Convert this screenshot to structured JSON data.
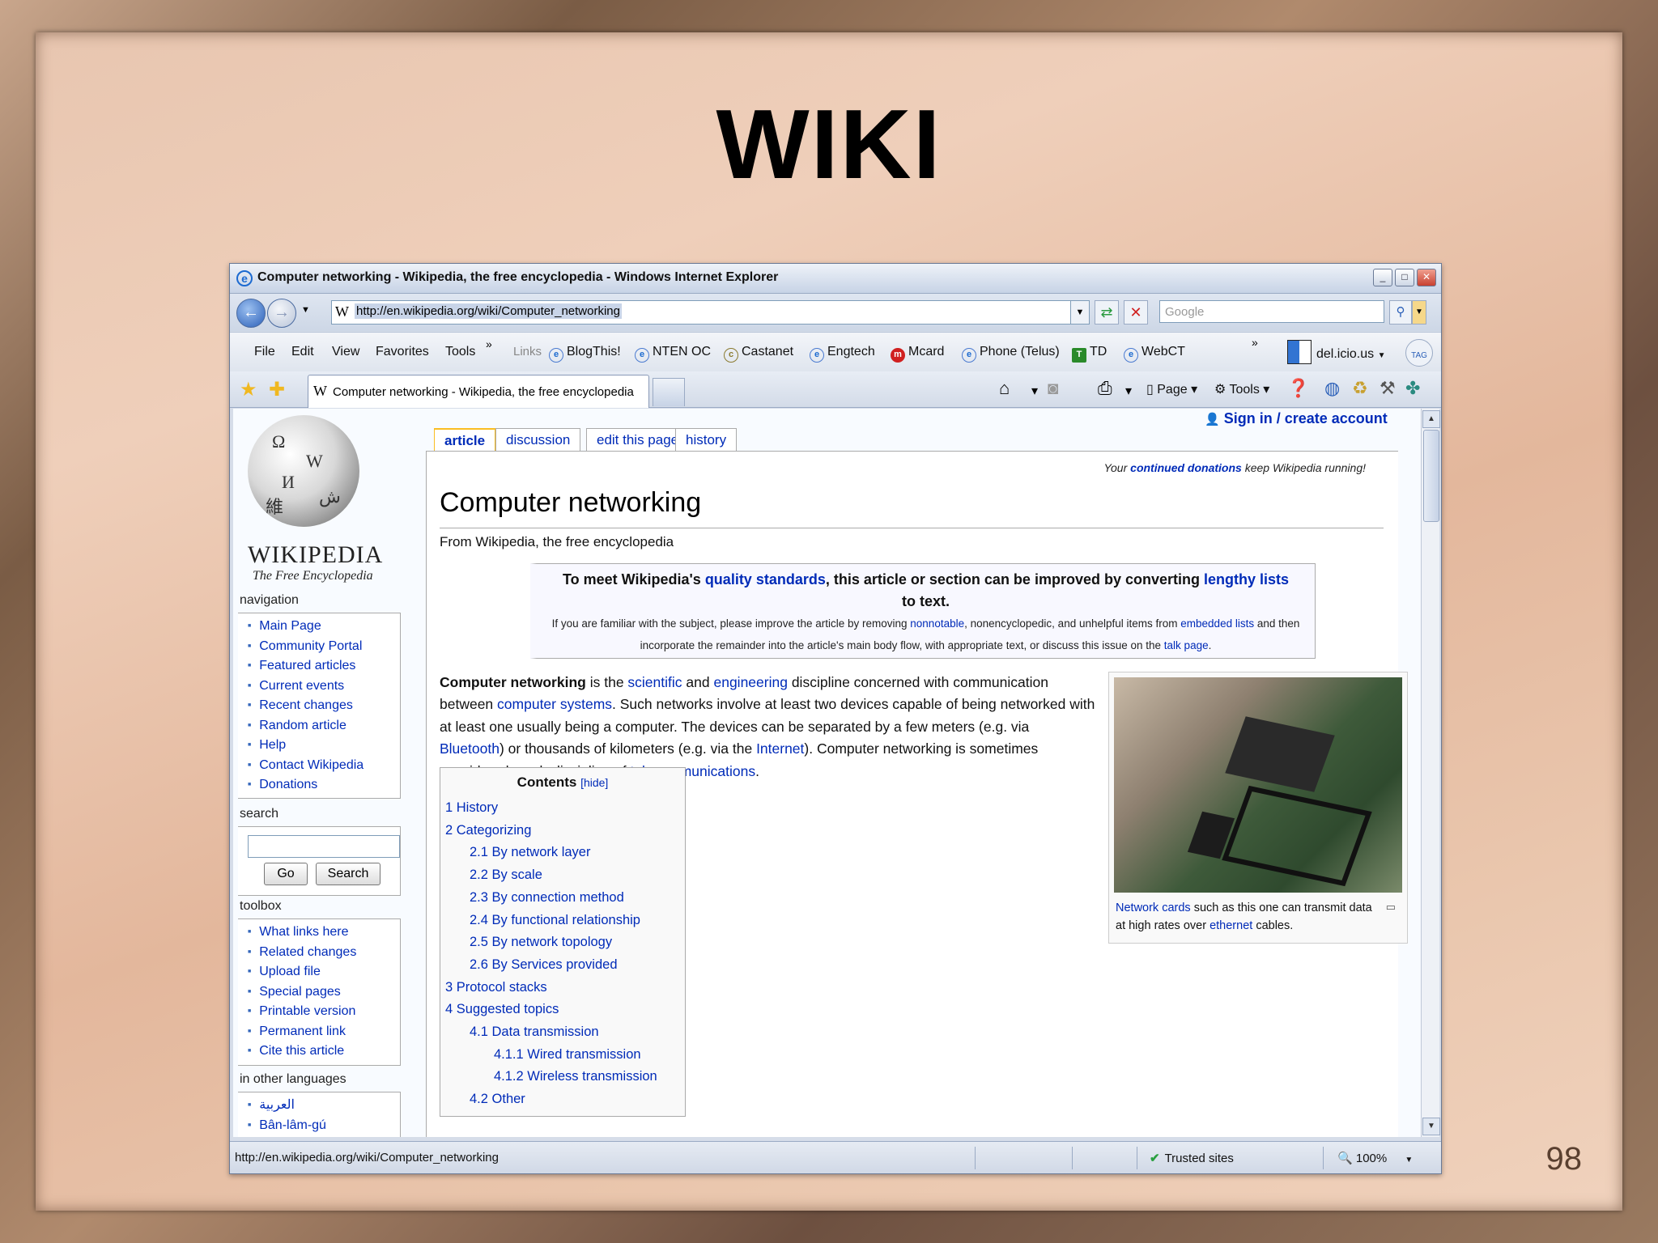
{
  "slide": {
    "title": "WIKI",
    "page_number": "98"
  },
  "window": {
    "title": "Computer networking - Wikipedia, the free encyclopedia - Windows Internet Explorer"
  },
  "address": {
    "url": "http://en.wikipedia.org/wiki/Computer_networking",
    "search_placeholder": "Google"
  },
  "menu": {
    "items": [
      "File",
      "Edit",
      "View",
      "Favorites",
      "Tools"
    ]
  },
  "links_bar": {
    "label": "Links",
    "items": [
      "BlogThis!",
      "NTEN OC",
      "Castanet",
      "Engtech",
      "Mcard",
      "Phone (Telus)",
      "TD",
      "WebCT"
    ],
    "delicious": "del.icio.us",
    "tag": "TAG"
  },
  "tab": {
    "label": "Computer networking - Wikipedia, the free encyclopedia"
  },
  "command_bar": {
    "page": "Page",
    "tools": "Tools"
  },
  "wiki": {
    "logo_word": "WIKIPEDIA",
    "logo_tagline": "The Free Encyclopedia",
    "signin": "Sign in / create account",
    "tabs": [
      "article",
      "discussion",
      "edit this page",
      "history"
    ],
    "donation_prefix": "Your",
    "donation_link": "continued donations",
    "donation_suffix": "keep Wikipedia running!",
    "title": "Computer networking",
    "from": "From Wikipedia, the free encyclopedia",
    "navigation": {
      "heading": "navigation",
      "items": [
        "Main Page",
        "Community Portal",
        "Featured articles",
        "Current events",
        "Recent changes",
        "Random article",
        "Help",
        "Contact Wikipedia",
        "Donations"
      ]
    },
    "search": {
      "heading": "search",
      "go": "Go",
      "search": "Search"
    },
    "toolbox": {
      "heading": "toolbox",
      "items": [
        "What links here",
        "Related changes",
        "Upload file",
        "Special pages",
        "Printable version",
        "Permanent link",
        "Cite this article"
      ]
    },
    "languages": {
      "heading": "in other languages",
      "items": [
        "العربية",
        "Bân-lâm-gú"
      ]
    },
    "notice": {
      "l1_a": "To meet Wikipedia's",
      "l1_link1": "quality standards",
      "l1_b": ", this article or section can be improved by converting",
      "l1_link2": "lengthy lists",
      "l1_c": "to text.",
      "l2_a": "If you are familiar with the subject, please improve the article by removing",
      "l2_link1": "nonnotable",
      "l2_b": ", nonencyclopedic, and unhelpful items from",
      "l2_link2": "embedded lists",
      "l2_c": "and then incorporate the remainder into the article's main body flow, with appropriate text, or discuss this issue on the",
      "l2_link3": "talk page",
      "l2_d": "."
    },
    "intro": {
      "bold": "Computer networking",
      "t1": "is the",
      "link_scientific": "scientific",
      "t2": "and",
      "link_engineering": "engineering",
      "t3": "discipline concerned with communication between",
      "link_computer_systems": "computer systems",
      "t4": ". Such networks involve at least two devices capable of being networked with at least one usually being a computer. The devices can be separated by a few meters (e.g. via",
      "link_bluetooth": "Bluetooth",
      "t5": ") or thousands of kilometers (e.g. via the",
      "link_internet": "Internet",
      "t6": "). Computer networking is sometimes considered a sub-discipline of",
      "link_telecom": "telecommunications",
      "t7": "."
    },
    "thumb": {
      "link1": "Network cards",
      "t1": "such as this one can transmit data at high rates over",
      "link2": "ethernet",
      "t2": "cables."
    },
    "toc": {
      "title": "Contents",
      "hide": "[hide]",
      "items": [
        "1 History",
        "2 Categorizing",
        "2.1 By network layer",
        "2.2 By scale",
        "2.3 By connection method",
        "2.4 By functional relationship",
        "2.5 By network topology",
        "2.6 By Services provided",
        "3 Protocol stacks",
        "4 Suggested topics",
        "4.1 Data transmission",
        "4.1.1 Wired transmission",
        "4.1.2 Wireless transmission",
        "4.2 Other"
      ]
    }
  },
  "status": {
    "url": "http://en.wikipedia.org/wiki/Computer_networking",
    "zone": "Trusted sites",
    "zoom": "100%"
  }
}
